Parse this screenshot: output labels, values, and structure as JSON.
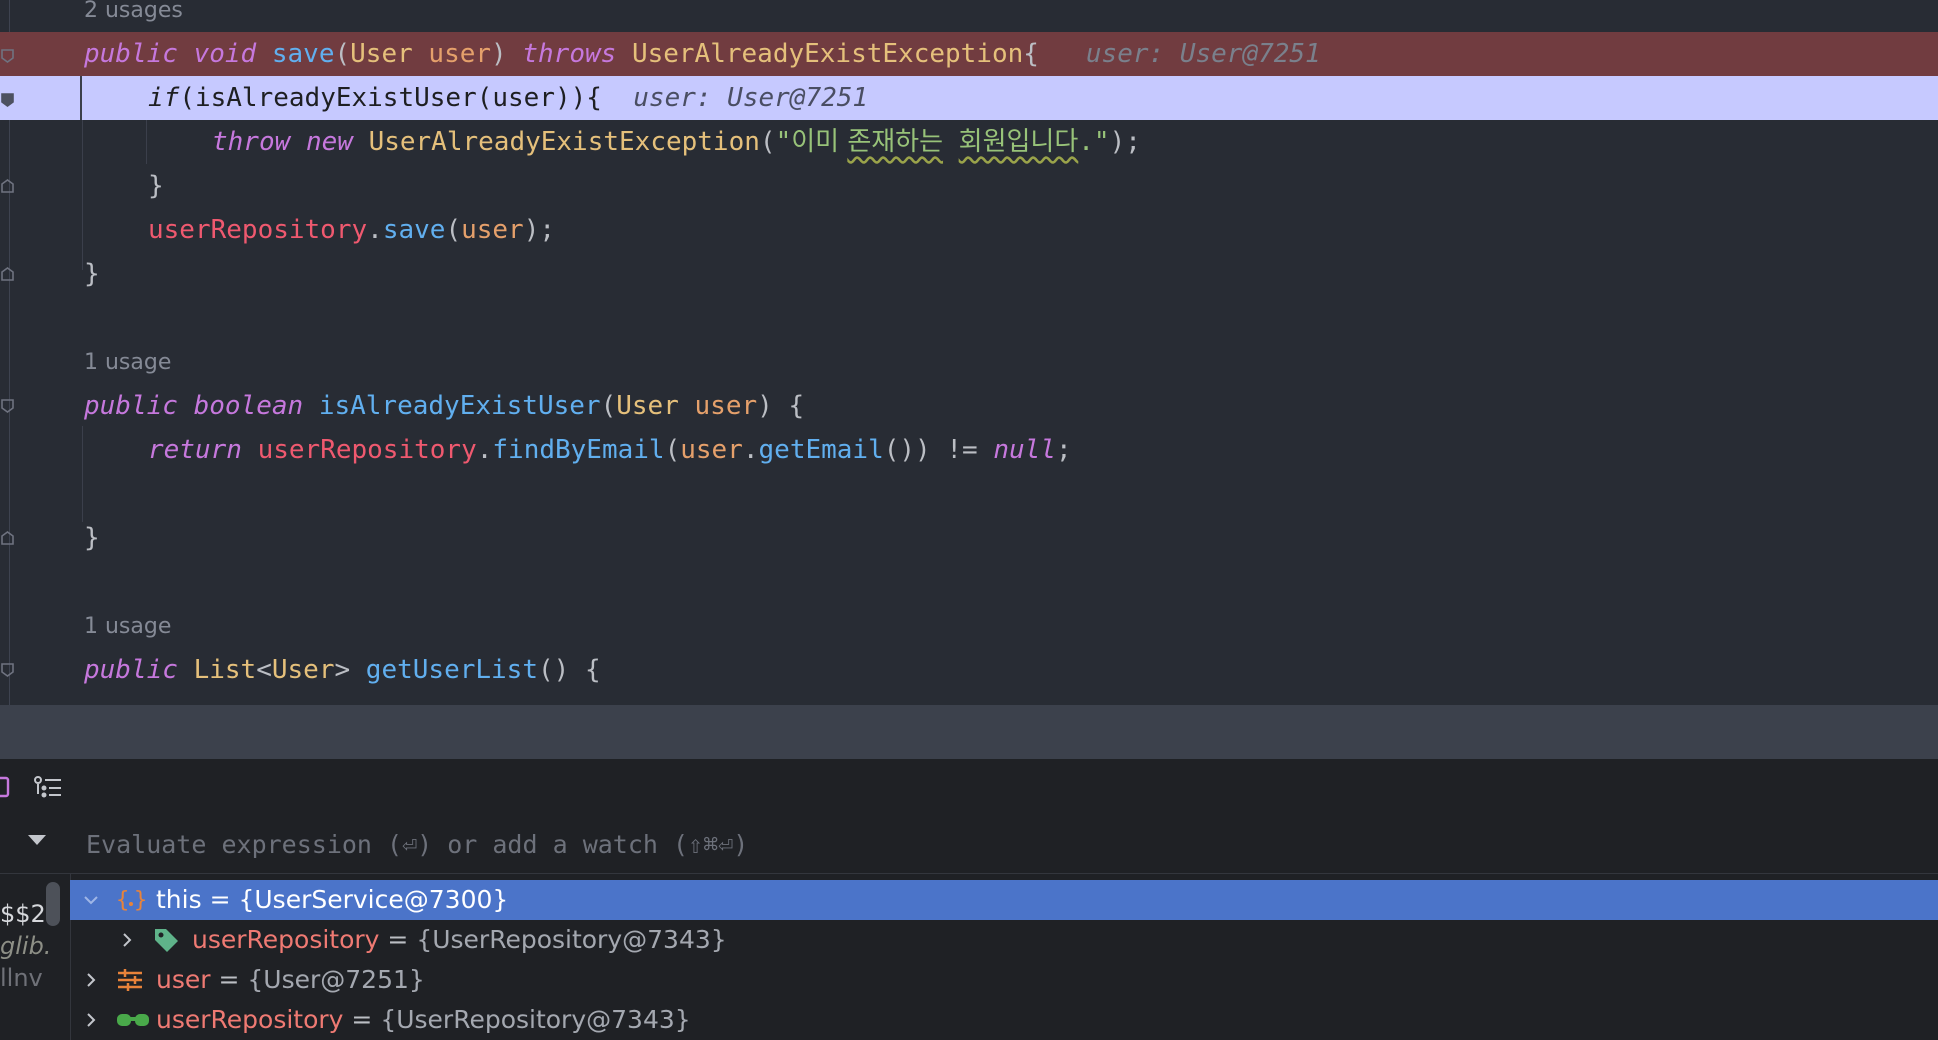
{
  "editor": {
    "usages": [
      "2 usages",
      "1 usage",
      "1 usage"
    ],
    "save_method": {
      "kw_public": "public",
      "kw_void": "void",
      "name": "save",
      "open": "(",
      "type_user": "User",
      "param": "user",
      "close": ")",
      "kw_throws": "throws",
      "exception": "UserAlreadyExistException",
      "brace": "{",
      "hint": "user: User@7251"
    },
    "if_line": {
      "kw_if": "if",
      "rest": "(isAlreadyExistUser(user)){",
      "hint": "user: User@7251"
    },
    "throw_line": {
      "kw_throw": "throw",
      "kw_new": "new",
      "exception": "UserAlreadyExistException",
      "open": "(",
      "quote_open": "\"",
      "str_plain": "이미 ",
      "str_word1": "존재하는",
      "space": " ",
      "str_word2": "회원입니다",
      "str_end": ".\"",
      "close": ");"
    },
    "close_if": "}",
    "repo_save": {
      "field": "userRepository",
      "dot": ".",
      "method": "save",
      "open": "(",
      "arg": "user",
      "close": ");"
    },
    "close_save": "}",
    "exist_method": {
      "kw_public": "public",
      "kw_boolean": "boolean",
      "name": "isAlreadyExistUser",
      "open": "(",
      "type_user": "User",
      "param": "user",
      "close": ") {"
    },
    "return_line": {
      "kw_return": "return",
      "field": "userRepository",
      "dot": ".",
      "method": "findByEmail",
      "open": "(",
      "arg": "user",
      "dot2": ".",
      "method2": "getEmail",
      "close": "()) != ",
      "kw_null": "null",
      "semi": ";"
    },
    "close_exist": "}",
    "list_method": {
      "kw_public": "public",
      "type_list": "List",
      "lt": "<",
      "type_user": "User",
      "gt": ">",
      "name": "getUserList",
      "rest": "() {"
    }
  },
  "debug": {
    "eval_placeholder": "Evaluate expression (⏎) or add a watch (⇧⌘⏎)",
    "left_strip": [
      "$$2",
      "glib.",
      "llnv"
    ],
    "variables": [
      {
        "name": "this",
        "eq": " = ",
        "value": "{UserService@7300}",
        "icon": "object-brackets-icon"
      },
      {
        "name": "userRepository",
        "eq": " = ",
        "value": "{UserRepository@7343}",
        "icon": "tag-icon"
      },
      {
        "name": "user",
        "eq": " = ",
        "value": "{User@7251}",
        "icon": "parameter-icon"
      },
      {
        "name": "userRepository",
        "eq": " = ",
        "value": "{UserRepository@7343}",
        "icon": "watch-glasses-icon"
      }
    ]
  },
  "colors": {
    "keyword": "#c678dd",
    "function": "#61afef",
    "type": "#e5c07b",
    "field": "#ef596f",
    "string": "#98c379",
    "error_line": "#713c40",
    "exec_line": "#c6c9ff",
    "selection": "#4b74c9"
  }
}
